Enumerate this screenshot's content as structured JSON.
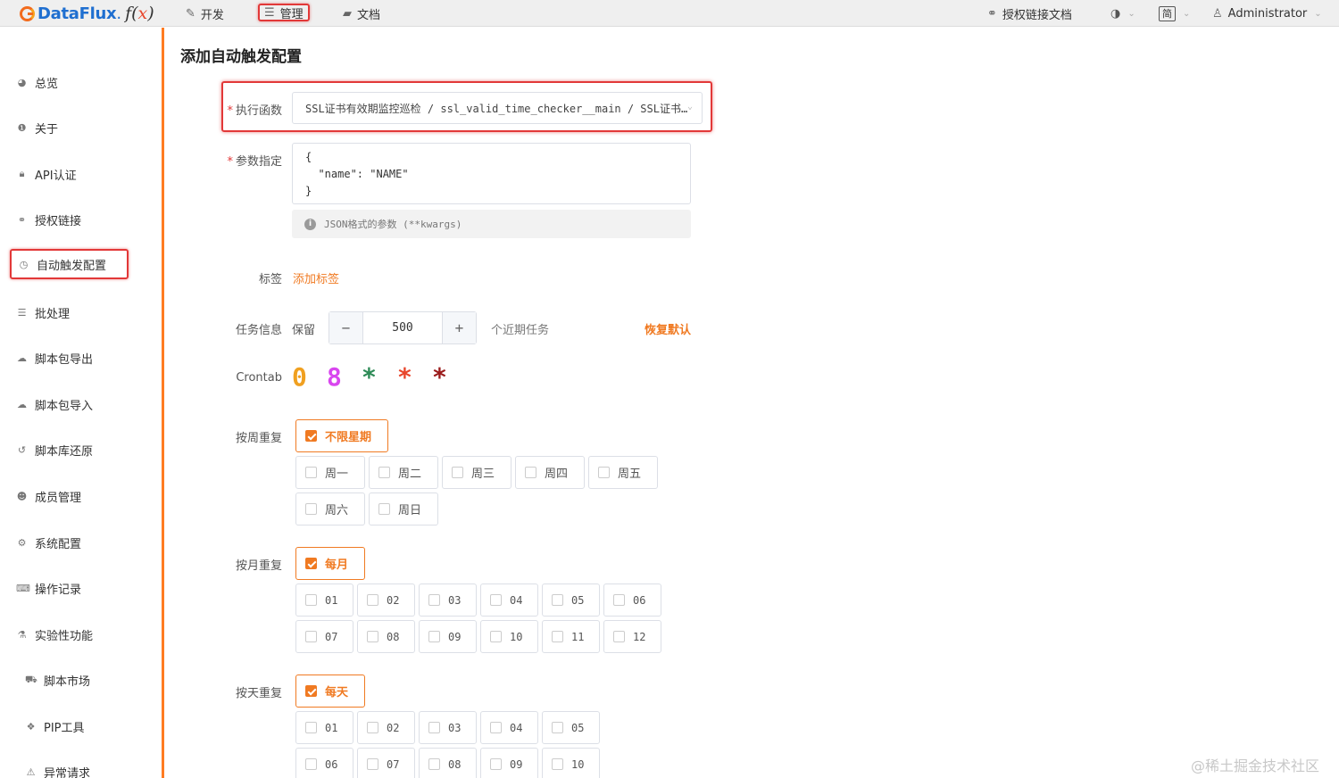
{
  "topbar": {
    "logo_text": "DataFlux",
    "logo_fx": "f",
    "logo_paren_open": "(",
    "logo_x": "x",
    "logo_paren_close": ")",
    "nav": {
      "dev": "开发",
      "admin": "管理",
      "docs": "文档"
    },
    "auth_docs": "授权链接文档",
    "lang": "简",
    "user": "Administrator"
  },
  "sidebar": {
    "items": [
      {
        "label": "总览",
        "icon": "dashboard-icon"
      },
      {
        "label": "关于",
        "icon": "info-icon"
      },
      {
        "label": "API认证",
        "icon": "lock-icon"
      },
      {
        "label": "授权链接",
        "icon": "link-icon"
      },
      {
        "label": "自动触发配置",
        "icon": "clock-icon",
        "active": true
      },
      {
        "label": "批处理",
        "icon": "list-icon"
      },
      {
        "label": "脚本包导出",
        "icon": "cloud-download-icon"
      },
      {
        "label": "脚本包导入",
        "icon": "cloud-upload-icon"
      },
      {
        "label": "脚本库还原",
        "icon": "history-icon"
      },
      {
        "label": "成员管理",
        "icon": "users-icon"
      },
      {
        "label": "系统配置",
        "icon": "gear-icon"
      },
      {
        "label": "操作记录",
        "icon": "keyboard-icon"
      },
      {
        "label": "实验性功能",
        "icon": "flask-icon"
      },
      {
        "label": "脚本市场",
        "icon": "cart-icon"
      },
      {
        "label": "PIP工具",
        "icon": "cubes-icon"
      },
      {
        "label": "异常请求",
        "icon": "warning-icon"
      }
    ]
  },
  "form": {
    "title": "添加自动触发配置",
    "func_label": "执行函数",
    "func_value": "SSL证书有效期监控巡检 / ssl_valid_time_checker__main / SSL证书…",
    "args_label": "参数指定",
    "args_value": "{\n  \"name\": \"NAME\"\n}",
    "args_hint": "JSON格式的参数 (**kwargs)",
    "tags_label": "标签",
    "add_tag": "添加标签",
    "task_label": "任务信息",
    "keep": "保留",
    "keep_value": "500",
    "minus": "−",
    "plus": "+",
    "recent": "个近期任务",
    "restore": "恢复默认",
    "crontab_label": "Crontab",
    "crontab": [
      "0",
      "8",
      "*",
      "*",
      "*"
    ],
    "crontab_colors": [
      "#f0a020",
      "#d946ef",
      "#2e8b57",
      "#e8462c",
      "#9b1c1c"
    ],
    "weekly_label": "按周重复",
    "weekly_all": "不限星期",
    "weekdays": [
      "周一",
      "周二",
      "周三",
      "周四",
      "周五",
      "周六",
      "周日"
    ],
    "monthly_label": "按月重复",
    "monthly_all": "每月",
    "months": [
      "01",
      "02",
      "03",
      "04",
      "05",
      "06",
      "07",
      "08",
      "09",
      "10",
      "11",
      "12"
    ],
    "daily_label": "按天重复",
    "daily_all": "每天",
    "days": [
      "01",
      "02",
      "03",
      "04",
      "05",
      "06",
      "07",
      "08",
      "09",
      "10"
    ]
  },
  "watermark": "@稀土掘金技术社区",
  "colors": {
    "accent": "#f07a22",
    "highlight": "#e23838",
    "brand_blue": "#1f6fd0"
  }
}
